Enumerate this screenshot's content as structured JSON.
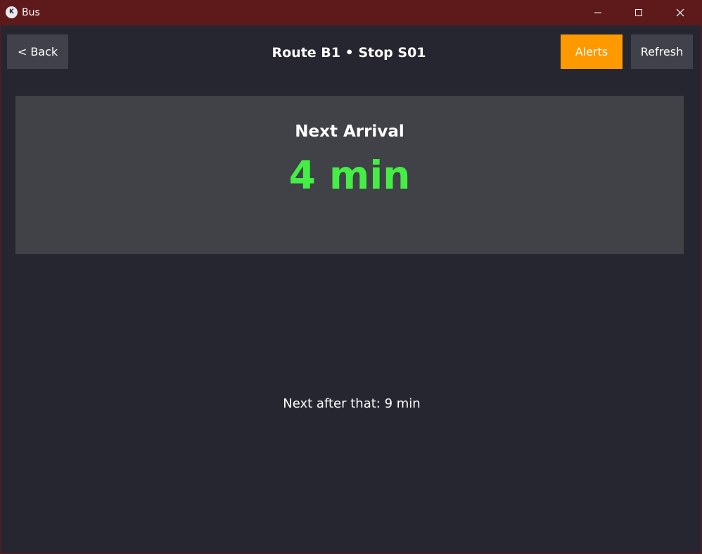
{
  "window": {
    "title": "Bus",
    "icon": "kivy-logo-icon",
    "icon_text": "K"
  },
  "header": {
    "back_label": "< Back",
    "title": "Route B1 • Stop S01",
    "alerts_label": "Alerts",
    "refresh_label": "Refresh"
  },
  "arrival": {
    "label": "Next Arrival",
    "value": "4 min"
  },
  "next_after": "Next after that: 9 min",
  "colors": {
    "titlebar": "#5e1a1a",
    "background": "#262630",
    "card": "#414148",
    "button": "#40414a",
    "alerts_accent": "#ff9900",
    "arrival_value": "#44ee44"
  }
}
